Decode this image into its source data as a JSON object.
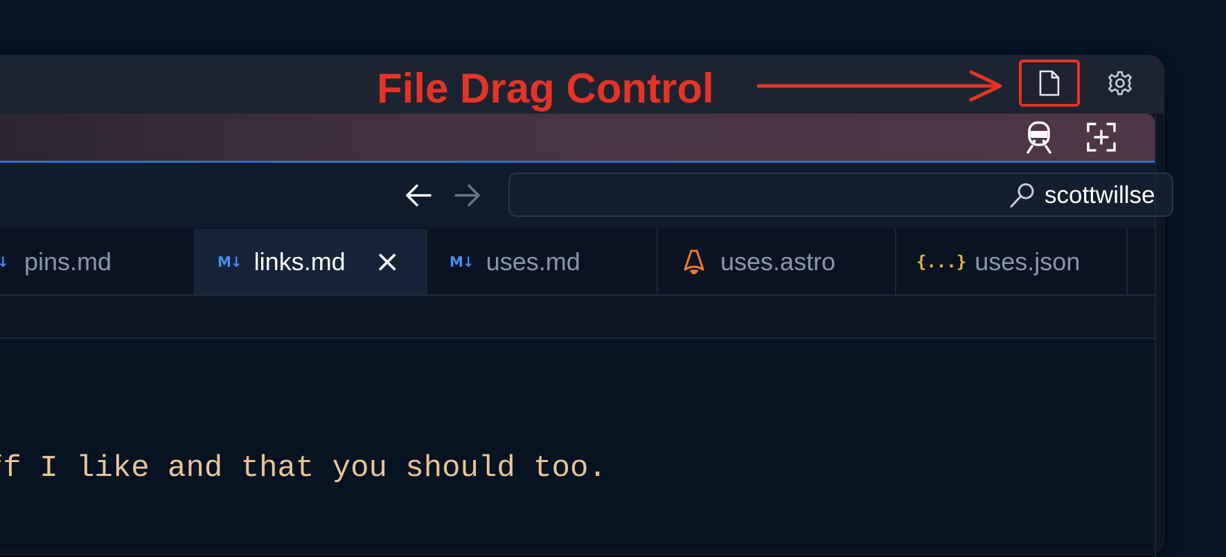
{
  "annotation": {
    "label": "File Drag Control",
    "color": "#e53425"
  },
  "titlebar": {
    "file_drag_icon": "file-icon",
    "settings_icon": "gear-icon"
  },
  "banner": {
    "left_icon": "train-icon",
    "right_icon": "add-selection-icon"
  },
  "navigation": {
    "back_icon": "arrow-left-icon",
    "forward_icon": "arrow-right-icon"
  },
  "search": {
    "icon": "search-icon",
    "value": "scottwillse"
  },
  "tabs": [
    {
      "label": "pins.md",
      "icon": "markdown-icon",
      "icon_glyph": "M↓",
      "active": false
    },
    {
      "label": "links.md",
      "icon": "markdown-icon",
      "icon_glyph": "M↓",
      "active": true,
      "close": "×"
    },
    {
      "label": "uses.md",
      "icon": "markdown-icon",
      "icon_glyph": "M↓",
      "active": false
    },
    {
      "label": "uses.astro",
      "icon": "astro-icon",
      "active": false
    },
    {
      "label": "uses.json",
      "icon": "json-icon",
      "icon_glyph": "{...}",
      "active": false
    }
  ],
  "editor": {
    "lines": [
      "ff I like and that you should too.",
      "'"
    ]
  },
  "colors": {
    "background": "#061424",
    "titlebar": "#1d2331",
    "accent_blue": "#2f6de0",
    "code_text": "#e8c597",
    "markdown_icon": "#4a8ef0",
    "astro_icon": "#f07a2c",
    "json_icon": "#e8b830"
  }
}
